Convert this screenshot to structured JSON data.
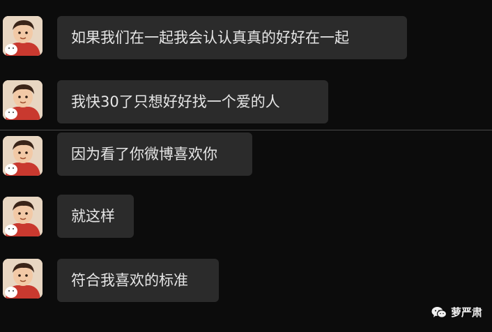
{
  "chat": {
    "messages": [
      {
        "text": "如果我们在一起我会认认真真的好好在一起"
      },
      {
        "text": "我快30了只想好好找一个爱的人"
      },
      {
        "text": "因为看了你微博喜欢你"
      },
      {
        "text": "就这样"
      },
      {
        "text": "符合我喜欢的标准"
      }
    ]
  },
  "watermark": {
    "label": "萝严肃",
    "icon": "wechat-icon"
  },
  "colors": {
    "background": "#0c0c0c",
    "bubble": "#2b2b2b",
    "text": "#e6e6e6"
  }
}
